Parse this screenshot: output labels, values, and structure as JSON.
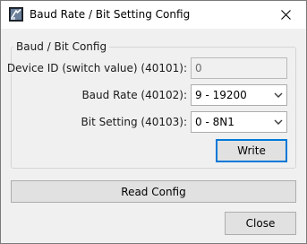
{
  "window": {
    "title": "Baud Rate / Bit Setting Config"
  },
  "group": {
    "title": "Baud / Bit Config"
  },
  "fields": {
    "device_id": {
      "label": "Device ID (switch value) (40101):",
      "value": "0"
    },
    "baud_rate": {
      "label": "Baud Rate (40102):",
      "value": "9 - 19200"
    },
    "bit_setting": {
      "label": "Bit Setting (40103):",
      "value": "0 - 8N1"
    }
  },
  "buttons": {
    "write": "Write",
    "read_config": "Read Config",
    "close": "Close"
  },
  "icons": {
    "app": "app-icon",
    "close": "close-icon",
    "dropdown": "chevron-down-icon"
  },
  "colors": {
    "accent": "#0078d7",
    "dialog_bg": "#f0f0f0",
    "button_bg": "#e1e1e1"
  }
}
